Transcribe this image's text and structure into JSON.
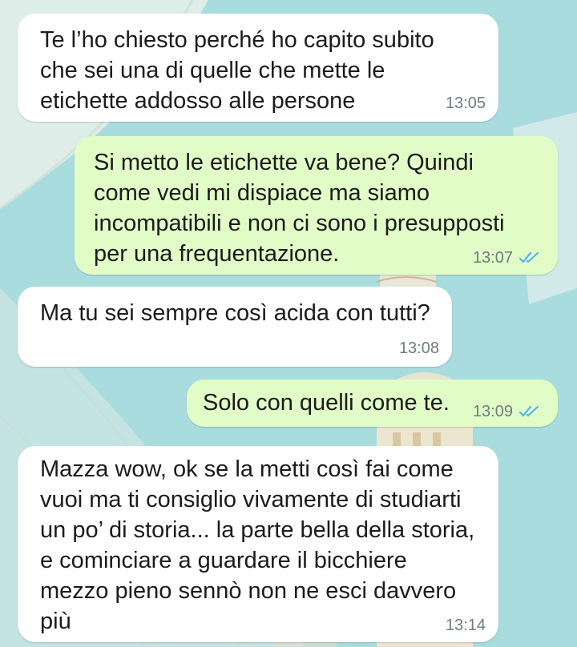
{
  "messages": [
    {
      "direction": "incoming",
      "text": "Te l’ho chiesto perché ho capito subito\nche sei una di quelle che mette le\netichette addosso alle persone",
      "time": "13:05"
    },
    {
      "direction": "outgoing",
      "text": "Si metto le etichette va bene? Quindi\ncome vedi mi dispiace ma siamo\nincompatibili e non ci sono i presupposti\nper una frequentazione.",
      "time": "13:07",
      "status": "read",
      "status_icon": "double-check-icon"
    },
    {
      "direction": "incoming",
      "text": "Ma tu sei sempre così acida con tutti?",
      "time": "13:08"
    },
    {
      "direction": "outgoing",
      "text": "Solo con quelli come te.",
      "time": "13:09",
      "status": "read",
      "status_icon": "double-check-icon"
    },
    {
      "direction": "incoming",
      "text": "Mazza wow, ok se la metti così fai come\nvuoi ma ti consiglio vivamente di studiarti\nun po’ di storia... la parte bella della storia,\ne cominciare a guardare il bicchiere\nmezzo pieno sennò non ne esci davvero\npiù",
      "time": "13:14"
    }
  ],
  "colors": {
    "incoming_bubble": "#ffffff",
    "outgoing_bubble": "#e2fcc8",
    "read_ticks": "#4fb6ec",
    "timestamp": "#6f7b7f",
    "wallpaper": "#a9dcdf"
  }
}
